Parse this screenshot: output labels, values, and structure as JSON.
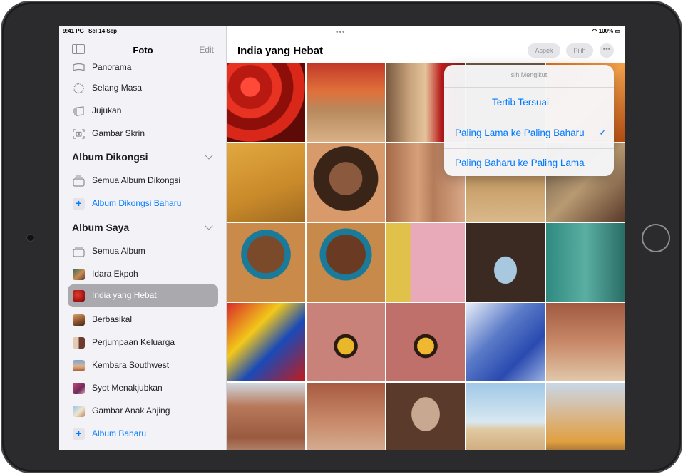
{
  "status": {
    "time": "9:41 PG",
    "date": "Sel 14 Sep",
    "battery": "100%"
  },
  "sidebar": {
    "title": "Foto",
    "edit": "Edit",
    "top_items": [
      {
        "label": "Panorama",
        "icon": "panorama-icon"
      },
      {
        "label": "Selang Masa",
        "icon": "timelapse-icon"
      },
      {
        "label": "Jujukan",
        "icon": "burst-icon"
      },
      {
        "label": "Gambar Skrin",
        "icon": "screenshot-icon"
      }
    ],
    "shared": {
      "title": "Album Dikongsi",
      "items": [
        {
          "label": "Semua Album Dikongsi",
          "icon": "shared-album-icon"
        },
        {
          "label": "Album Dikongsi Baharu",
          "icon": "plus-icon"
        }
      ]
    },
    "my_albums": {
      "title": "Album Saya",
      "items": [
        {
          "label": "Semua Album",
          "icon": "album-stack-icon"
        },
        {
          "label": "Idara Ekpoh"
        },
        {
          "label": "India yang Hebat"
        },
        {
          "label": "Berbasikal"
        },
        {
          "label": "Perjumpaan Keluarga"
        },
        {
          "label": "Kembara Southwest"
        },
        {
          "label": "Syot Menakjubkan"
        },
        {
          "label": "Gambar Anak Anjing"
        },
        {
          "label": "Album Baharu",
          "icon": "plus-icon"
        }
      ]
    }
  },
  "main": {
    "title": "India yang Hebat",
    "aspect_label": "Aspek",
    "select_label": "Pilih",
    "more_label": "•••"
  },
  "popover": {
    "header": "Isih Mengikut:",
    "options": [
      {
        "label": "Tertib Tersuai",
        "checked": false
      },
      {
        "label": "Paling Lama ke Paling Baharu",
        "checked": true
      },
      {
        "label": "Paling Baharu ke Paling Lama",
        "checked": false
      }
    ],
    "check_glyph": "✓"
  },
  "colors": {
    "accent": "#007aff",
    "selected_row": "#a9a9ae"
  }
}
